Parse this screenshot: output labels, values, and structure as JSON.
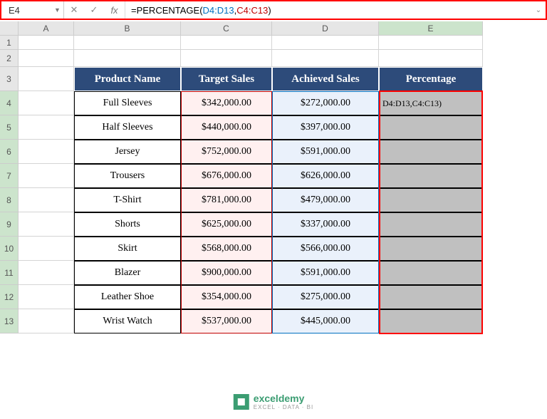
{
  "namebox": "E4",
  "formula": {
    "prefix": "=PERCENTAGE(",
    "arg1": "D4:D13",
    "sep": ",",
    "arg2": "C4:C13",
    "suffix": ")"
  },
  "columns": [
    "A",
    "B",
    "C",
    "D",
    "E"
  ],
  "rows": [
    "1",
    "2",
    "3",
    "4",
    "5",
    "6",
    "7",
    "8",
    "9",
    "10",
    "11",
    "12",
    "13"
  ],
  "headers": {
    "b": "Product Name",
    "c": "Target Sales",
    "d": "Achieved Sales",
    "e": "Percentage"
  },
  "e4_display": "D4:D13,C4:C13)",
  "data": [
    {
      "b": "Full Sleeves",
      "c": "$342,000.00",
      "d": "$272,000.00"
    },
    {
      "b": "Half Sleeves",
      "c": "$440,000.00",
      "d": "$397,000.00"
    },
    {
      "b": "Jersey",
      "c": "$752,000.00",
      "d": "$591,000.00"
    },
    {
      "b": "Trousers",
      "c": "$676,000.00",
      "d": "$626,000.00"
    },
    {
      "b": "T-Shirt",
      "c": "$781,000.00",
      "d": "$479,000.00"
    },
    {
      "b": "Shorts",
      "c": "$625,000.00",
      "d": "$337,000.00"
    },
    {
      "b": "Skirt",
      "c": "$568,000.00",
      "d": "$566,000.00"
    },
    {
      "b": "Blazer",
      "c": "$900,000.00",
      "d": "$591,000.00"
    },
    {
      "b": "Leather Shoe",
      "c": "$354,000.00",
      "d": "$275,000.00"
    },
    {
      "b": "Wrist Watch",
      "c": "$537,000.00",
      "d": "$445,000.00"
    }
  ],
  "watermark": {
    "brand": "exceldemy",
    "tag": "EXCEL · DATA · BI"
  },
  "chart_data": {
    "type": "table",
    "title": "Sales Target vs Achieved",
    "columns": [
      "Product Name",
      "Target Sales",
      "Achieved Sales",
      "Percentage"
    ],
    "rows": [
      [
        "Full Sleeves",
        342000,
        272000,
        null
      ],
      [
        "Half Sleeves",
        440000,
        397000,
        null
      ],
      [
        "Jersey",
        752000,
        591000,
        null
      ],
      [
        "Trousers",
        676000,
        626000,
        null
      ],
      [
        "T-Shirt",
        781000,
        479000,
        null
      ],
      [
        "Shorts",
        625000,
        337000,
        null
      ],
      [
        "Skirt",
        568000,
        566000,
        null
      ],
      [
        "Blazer",
        900000,
        591000,
        null
      ],
      [
        "Leather Shoe",
        354000,
        275000,
        null
      ],
      [
        "Wrist Watch",
        537000,
        445000,
        null
      ]
    ]
  }
}
